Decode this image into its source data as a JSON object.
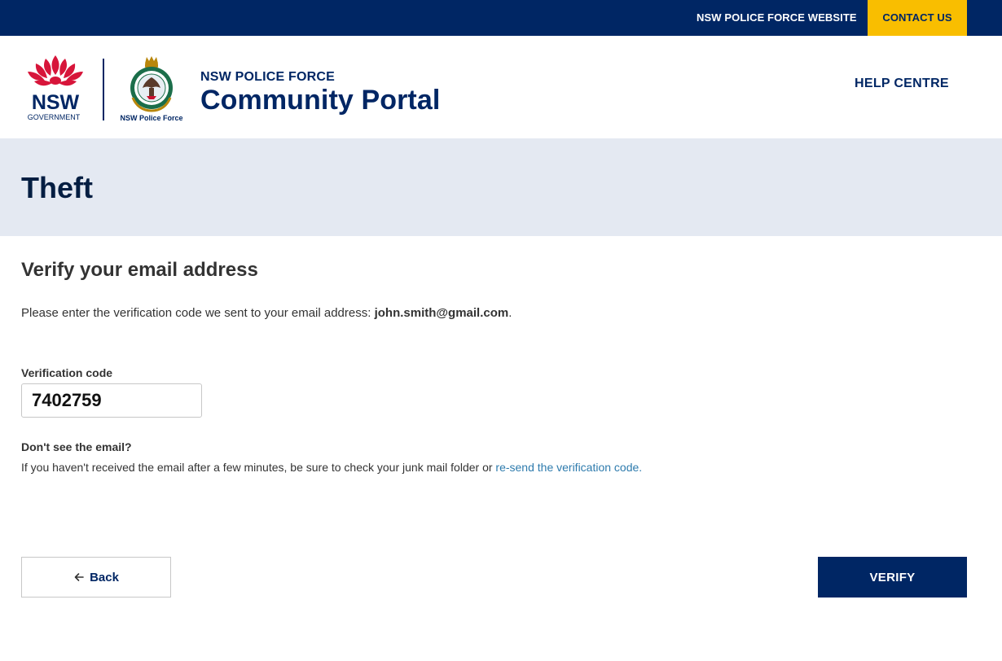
{
  "topbar": {
    "website_link": "NSW POLICE FORCE WEBSITE",
    "contact_link": "CONTACT US"
  },
  "header": {
    "portal_subtitle": "NSW POLICE FORCE",
    "portal_title": "Community Portal",
    "help_link": "HELP CENTRE",
    "nsw_logo_text": "NSW",
    "nsw_logo_subtext": "GOVERNMENT",
    "police_logo_caption": "NSW Police Force"
  },
  "page": {
    "title": "Theft"
  },
  "verify": {
    "heading": "Verify your email address",
    "instruction_prefix": "Please enter the verification code we sent to your email address: ",
    "email": "john.smith@gmail.com",
    "instruction_suffix": ".",
    "code_label": "Verification code",
    "code_value": "7402759",
    "help_heading": "Don't see the email?",
    "help_text": "If you haven't received the email after a few minutes, be sure to check your junk mail folder or ",
    "resend_link": "re-send the verification code."
  },
  "actions": {
    "back_label": "Back",
    "verify_label": "VERIFY"
  },
  "icons": {
    "back": "arrow-left-icon"
  },
  "colors": {
    "navy": "#002664",
    "gold": "#f9be00",
    "band": "#e4e9f2",
    "link": "#2e7bad",
    "waratah_red": "#d7153a"
  }
}
